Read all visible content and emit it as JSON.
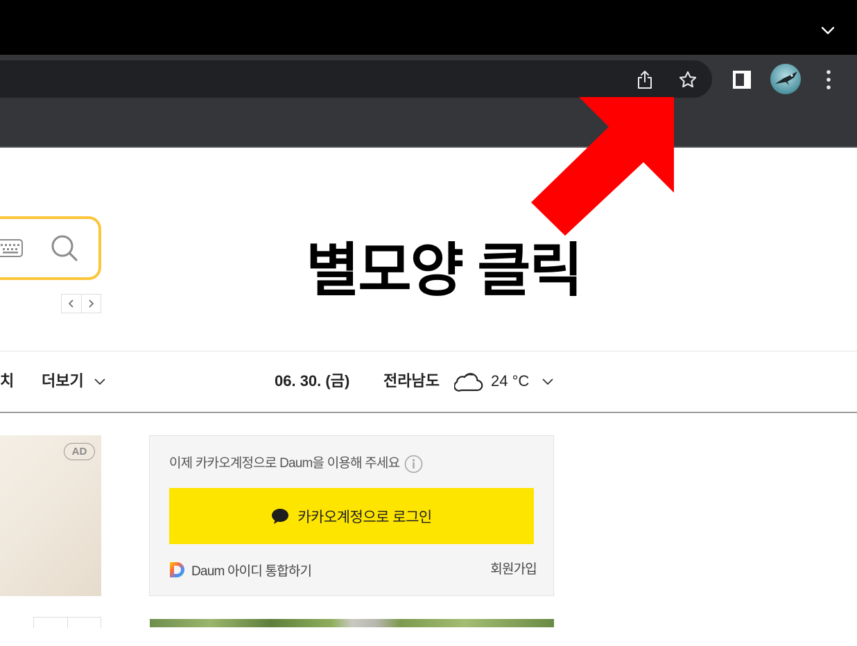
{
  "window": {
    "controls_icon": "chevron-down-icon"
  },
  "toolbar": {
    "share_icon": "share-icon",
    "bookmark_icon": "star-icon",
    "side_panel_icon": "side-panel-icon",
    "profile_icon": "avatar",
    "menu_icon": "kebab-menu-icon"
  },
  "annotation": {
    "text": "별모양 클릭",
    "arrow_color": "#ff0000"
  },
  "search": {
    "keyboard_icon": "keyboard-icon",
    "search_icon": "search-icon",
    "border_color": "#fcc63c"
  },
  "carousel": {
    "prev_icon": "chevron-left-icon",
    "next_icon": "chevron-right-icon"
  },
  "nav": {
    "partial_item": "치",
    "more_label": "더보기",
    "more_icon": "chevron-down-icon"
  },
  "weather": {
    "date": "06. 30. (금)",
    "location": "전라남도",
    "condition_icon": "cloud-icon",
    "temperature": "24 °C",
    "expand_icon": "chevron-down-icon"
  },
  "ad": {
    "badge": "AD"
  },
  "login": {
    "prompt": "이제 카카오계정으로 Daum을 이용해 주세요",
    "info_icon": "info-icon",
    "button_label": "카카오계정으로 로그인",
    "button_icon": "chat-bubble-icon",
    "button_color": "#fee500",
    "daum_logo": "daum-logo-icon",
    "daum_id_label": "Daum 아이디 통합하기",
    "signup_label": "회원가입"
  }
}
